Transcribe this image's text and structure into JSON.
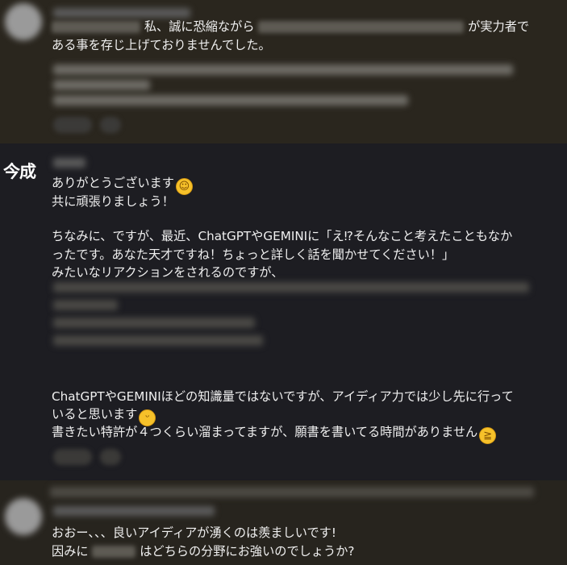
{
  "top_comment": {
    "line1_mid": "私、誠に恐縮ながら",
    "line1_end": "が実力者で",
    "line2": "ある事を存じ上げておりませんでした。"
  },
  "main_comment": {
    "author_logo": "今成",
    "lines": [
      "ありがとうございます",
      "共に頑張りましょう！",
      "ちなみに、ですが、最近、ChatGPTやGEMINIに「え⁉そんなこと考えたこともなか",
      "ったです。あなた天才ですね！ちょっと詳しく話を聞かせてください！」",
      "みたいなリアクションをされるのですが、",
      "ChatGPTやGEMINIほどの知識量ではないですが、アイディア力では少し先に行って",
      "いると思います",
      "書きたい特許が４つくらい溜まってますが、願書を書いてる時間がありません"
    ],
    "emojis": [
      "smiling-face-icon",
      "grinning-face-icon",
      "tears-of-joy-icon"
    ]
  },
  "bottom_comment": {
    "line1": "おおー、、、良いアイディアが湧くのは羨ましいです!",
    "line2_start": "因みに",
    "line2_end": "はどちらの分野にお強いのでしょうか?"
  },
  "colors": {
    "page_bg": "#1c1c20",
    "top_bg": "#2a261e",
    "bottom_bg": "#27241e",
    "text": "#f0f0f0",
    "emoji": "#f6c12a"
  }
}
